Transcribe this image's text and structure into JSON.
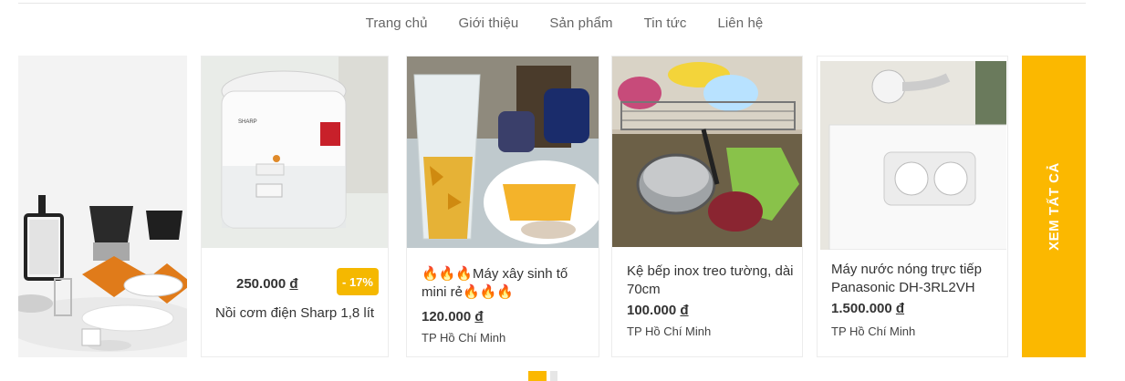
{
  "nav": {
    "items": [
      "Trang chủ",
      "Giới thiệu",
      "Sản phẩm",
      "Tin tức",
      "Liên hệ"
    ]
  },
  "products": [
    {
      "title": "Nồi cơm điện Sharp 1,8 lít",
      "price": "250.000",
      "currency": "đ",
      "discount": "- 17%",
      "location": ""
    },
    {
      "title": "🔥🔥🔥Máy xây sinh tố mini rẻ🔥🔥🔥",
      "price": "120.000",
      "currency": "đ",
      "location": "TP Hồ Chí Minh"
    },
    {
      "title": "Kệ bếp inox treo tường, dài 70cm",
      "price": "100.000",
      "currency": "đ",
      "location": "TP Hồ Chí Minh"
    },
    {
      "title": "Máy nước nóng trực tiếp Panasonic DH-3RL2VH",
      "price": "1.500.000",
      "currency": "đ",
      "location": "TP Hồ Chí Minh"
    }
  ],
  "see_all": "XEM TẤT CẢ",
  "colors": {
    "accent": "#fbb800"
  }
}
